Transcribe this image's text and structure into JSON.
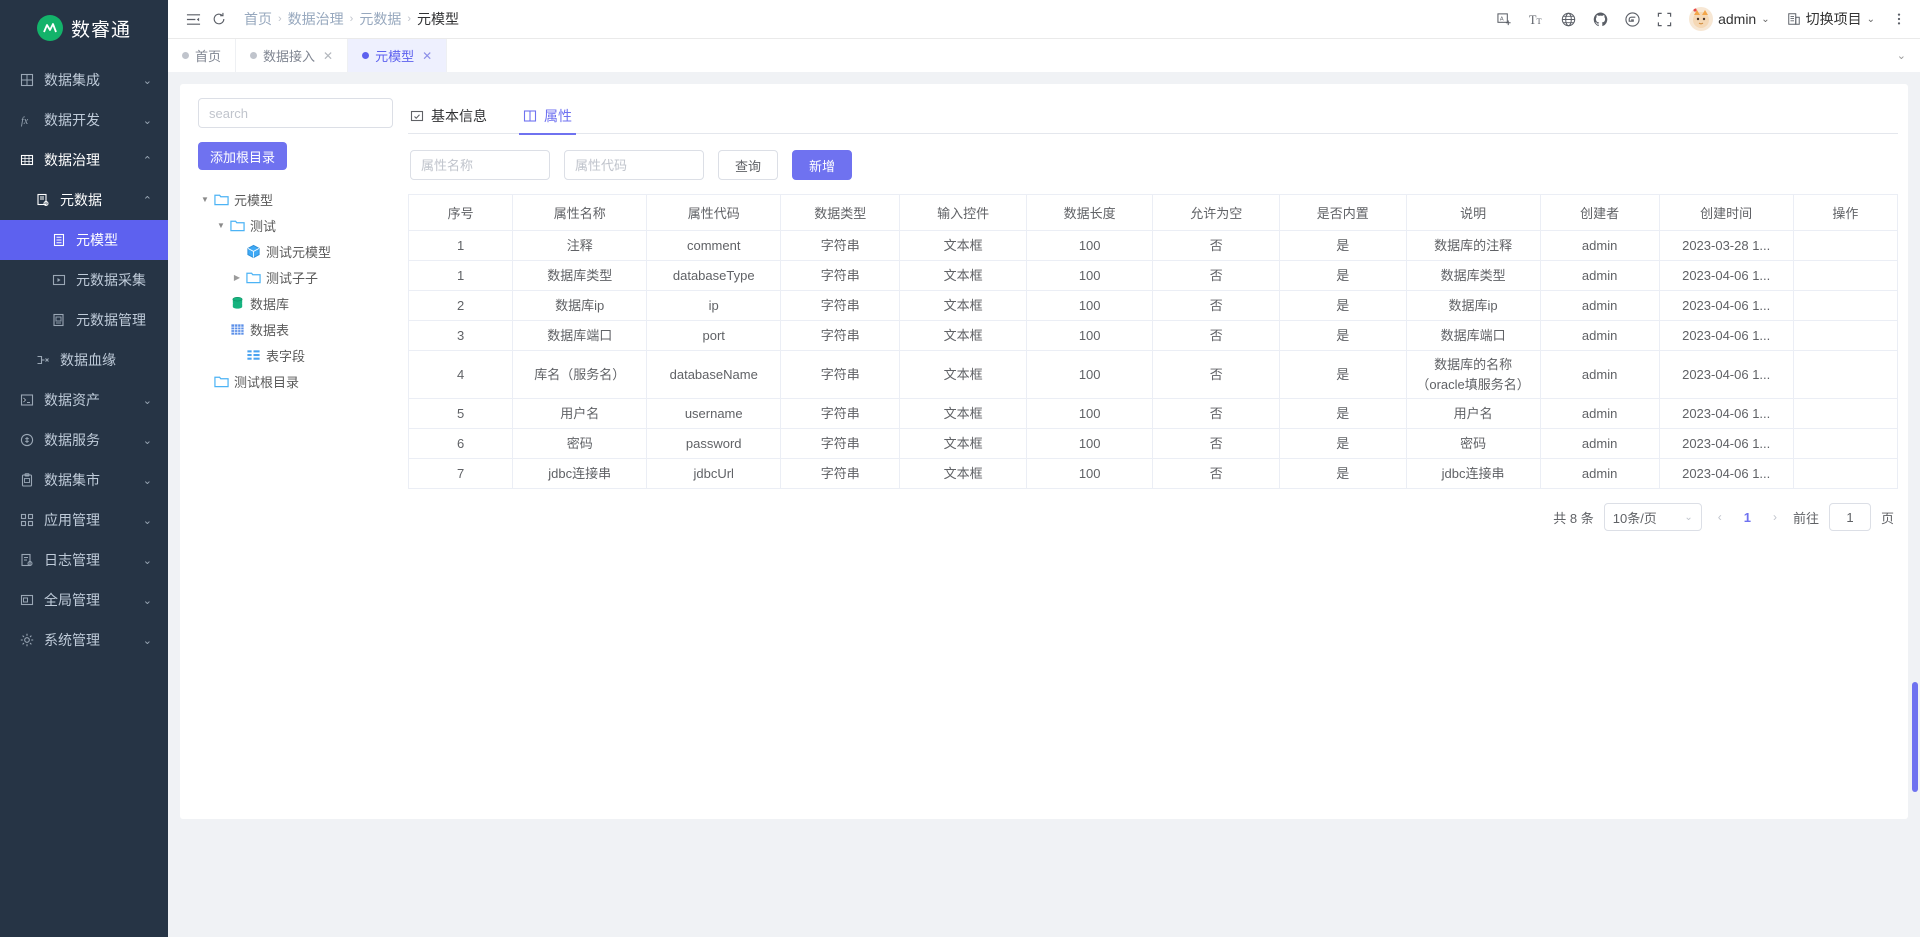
{
  "app": {
    "name": "数睿通",
    "logo_letter": "M"
  },
  "sidebar": {
    "items": [
      {
        "label": "数据集成",
        "icon": "grid-icon",
        "level": 1,
        "expandable": true,
        "state": "collapsed"
      },
      {
        "label": "数据开发",
        "icon": "function-icon",
        "level": 1,
        "expandable": true,
        "state": "collapsed"
      },
      {
        "label": "数据治理",
        "icon": "table-icon",
        "level": 1,
        "expandable": true,
        "state": "expanded"
      },
      {
        "label": "元数据",
        "icon": "metadata-icon",
        "level": 2,
        "expandable": true,
        "state": "expanded"
      },
      {
        "label": "元模型",
        "icon": "model-icon",
        "level": 3,
        "expandable": false,
        "state": "selected"
      },
      {
        "label": "元数据采集",
        "icon": "collect-icon",
        "level": 3,
        "expandable": false,
        "state": "normal"
      },
      {
        "label": "元数据管理",
        "icon": "manage-icon",
        "level": 3,
        "expandable": false,
        "state": "normal"
      },
      {
        "label": "数据血缘",
        "icon": "lineage-icon",
        "level": 2,
        "expandable": false,
        "state": "normal"
      },
      {
        "label": "数据资产",
        "icon": "asset-icon",
        "level": 1,
        "expandable": true,
        "state": "collapsed"
      },
      {
        "label": "数据服务",
        "icon": "service-icon",
        "level": 1,
        "expandable": true,
        "state": "collapsed"
      },
      {
        "label": "数据集市",
        "icon": "market-icon",
        "level": 1,
        "expandable": true,
        "state": "collapsed"
      },
      {
        "label": "应用管理",
        "icon": "app-icon",
        "level": 1,
        "expandable": true,
        "state": "collapsed"
      },
      {
        "label": "日志管理",
        "icon": "log-icon",
        "level": 1,
        "expandable": true,
        "state": "collapsed"
      },
      {
        "label": "全局管理",
        "icon": "global-icon",
        "level": 1,
        "expandable": true,
        "state": "collapsed"
      },
      {
        "label": "系统管理",
        "icon": "gear-icon",
        "level": 1,
        "expandable": true,
        "state": "collapsed"
      }
    ]
  },
  "header": {
    "breadcrumb": [
      "首页",
      "数据治理",
      "元数据",
      "元模型"
    ],
    "icons": [
      "collapse-menu-icon",
      "refresh-icon"
    ],
    "right_icons": [
      "image-icon",
      "font-size-icon",
      "globe-icon",
      "github-icon",
      "gitee-icon",
      "fullscreen-icon"
    ],
    "user": "admin",
    "project_switch": "切换项目",
    "more": "more-icon"
  },
  "view_tabs": [
    {
      "label": "首页",
      "closable": false,
      "active": false
    },
    {
      "label": "数据接入",
      "closable": true,
      "active": false
    },
    {
      "label": "元模型",
      "closable": true,
      "active": true
    }
  ],
  "tree_panel": {
    "search_placeholder": "search",
    "search_value": "",
    "add_root_label": "添加根目录",
    "nodes": [
      {
        "label": "元模型",
        "icon": "folder-icon",
        "indent": 0,
        "caret": "down"
      },
      {
        "label": "测试",
        "icon": "folder-icon",
        "indent": 1,
        "caret": "down"
      },
      {
        "label": "测试元模型",
        "icon": "cube-icon",
        "indent": 2,
        "caret": "none"
      },
      {
        "label": "测试子子",
        "icon": "folder-icon",
        "indent": 2,
        "caret": "right"
      },
      {
        "label": "数据库",
        "icon": "database-icon",
        "indent": 1,
        "caret": "none"
      },
      {
        "label": "数据表",
        "icon": "table-grid-icon",
        "indent": 1,
        "caret": "none"
      },
      {
        "label": "表字段",
        "icon": "columns-icon",
        "indent": 2,
        "caret": "none"
      },
      {
        "label": "测试根目录",
        "icon": "folder-icon",
        "indent": 0,
        "caret": "none"
      }
    ]
  },
  "inner_tabs": [
    {
      "label": "基本信息",
      "icon": "info-icon",
      "active": false
    },
    {
      "label": "属性",
      "icon": "book-icon",
      "active": true
    }
  ],
  "filters": {
    "name_placeholder": "属性名称",
    "name_value": "",
    "code_placeholder": "属性代码",
    "code_value": "",
    "query_label": "查询",
    "add_label": "新增"
  },
  "table": {
    "columns": [
      "序号",
      "属性名称",
      "属性代码",
      "数据类型",
      "输入控件",
      "数据长度",
      "允许为空",
      "是否内置",
      "说明",
      "创建者",
      "创建时间",
      "操作"
    ],
    "rows": [
      [
        "1",
        "注释",
        "comment",
        "字符串",
        "文本框",
        "100",
        "否",
        "是",
        "数据库的注释",
        "admin",
        "2023-03-28 1...",
        ""
      ],
      [
        "1",
        "数据库类型",
        "databaseType",
        "字符串",
        "文本框",
        "100",
        "否",
        "是",
        "数据库类型",
        "admin",
        "2023-04-06 1...",
        ""
      ],
      [
        "2",
        "数据库ip",
        "ip",
        "字符串",
        "文本框",
        "100",
        "否",
        "是",
        "数据库ip",
        "admin",
        "2023-04-06 1...",
        ""
      ],
      [
        "3",
        "数据库端口",
        "port",
        "字符串",
        "文本框",
        "100",
        "否",
        "是",
        "数据库端口",
        "admin",
        "2023-04-06 1...",
        ""
      ],
      [
        "4",
        "库名（服务名）",
        "databaseName",
        "字符串",
        "文本框",
        "100",
        "否",
        "是",
        "数据库的名称（oracle填服务名）",
        "admin",
        "2023-04-06 1...",
        ""
      ],
      [
        "5",
        "用户名",
        "username",
        "字符串",
        "文本框",
        "100",
        "否",
        "是",
        "用户名",
        "admin",
        "2023-04-06 1...",
        ""
      ],
      [
        "6",
        "密码",
        "password",
        "字符串",
        "文本框",
        "100",
        "否",
        "是",
        "密码",
        "admin",
        "2023-04-06 1...",
        ""
      ],
      [
        "7",
        "jdbc连接串",
        "jdbcUrl",
        "字符串",
        "文本框",
        "100",
        "否",
        "是",
        "jdbc连接串",
        "admin",
        "2023-04-06 1...",
        ""
      ]
    ]
  },
  "pagination": {
    "total_text": "共 8 条",
    "page_size": "10条/页",
    "prev": "‹",
    "current_page": "1",
    "next": "›",
    "goto_label": "前往",
    "goto_value": "1",
    "page_unit": "页"
  },
  "colors": {
    "accent": "#6f72f0",
    "sidebar_bg": "#263445",
    "selected_bg": "#5d61ef",
    "brand_green": "#13b36a"
  }
}
